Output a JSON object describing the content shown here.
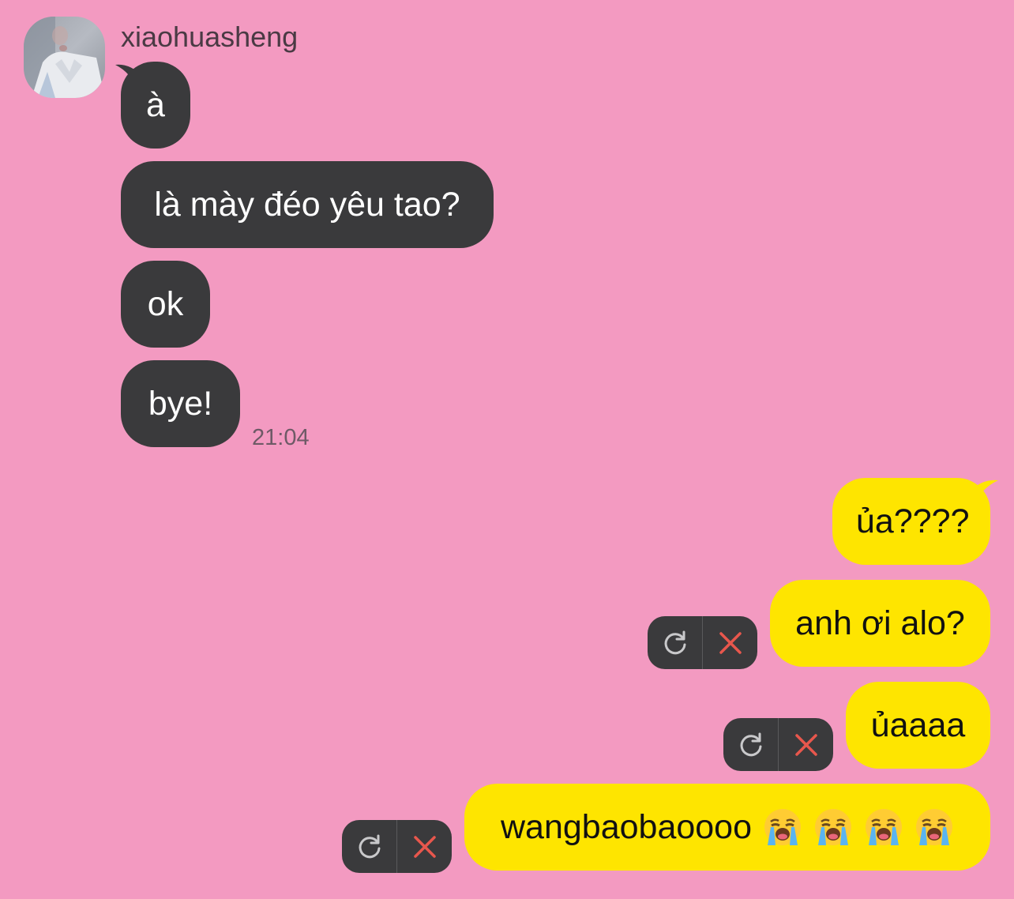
{
  "colors": {
    "background": "#f39ac1",
    "incoming_bubble": "#3a3a3c",
    "outgoing_bubble": "#fee500",
    "retry_icon": "#c9c9cb",
    "delete_icon": "#e8574d"
  },
  "contact": {
    "name": "xiaohuasheng",
    "avatar_icon": "profile-photo"
  },
  "incoming_messages": [
    {
      "text": "à"
    },
    {
      "text": "là mày đéo yêu tao?"
    },
    {
      "text": "ok"
    },
    {
      "text": "bye!"
    }
  ],
  "incoming_time": "21:04",
  "outgoing_messages": [
    {
      "text": "ủa????",
      "failed": false
    },
    {
      "text": "anh ơi alo?",
      "failed": true
    },
    {
      "text": "ủaaaa",
      "failed": true
    },
    {
      "text": "wangbaobaoooo",
      "emoji": [
        "😭",
        "😭",
        "😭",
        "😭"
      ],
      "failed": true
    }
  ],
  "failed_actions": {
    "retry_icon": "retry-icon",
    "delete_icon": "delete-icon"
  }
}
